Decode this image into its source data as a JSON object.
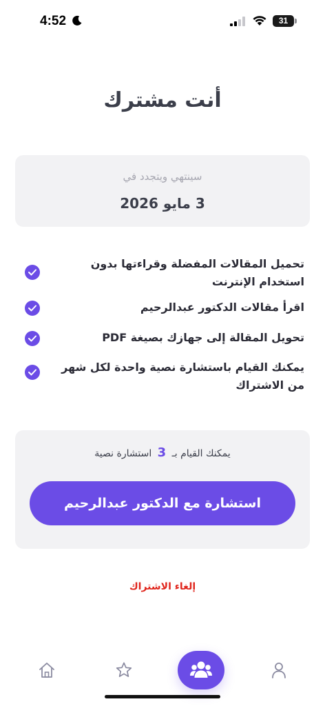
{
  "status_bar": {
    "time": "4:52",
    "battery": "31",
    "battery_level_percent": 31
  },
  "page": {
    "title": "أنت مشترك"
  },
  "renewal": {
    "label": "سينتهي ويتجدد في",
    "date": "3 مايو 2026"
  },
  "features": [
    {
      "text": "تحميل المقالات المفضلة وقراءتها بدون استخدام الإنترنت",
      "icon": "check-circle-icon"
    },
    {
      "text": "اقرأ مقالات الدكتور عبدالرحيم",
      "icon": "check-circle-icon"
    },
    {
      "text": "تحويل المقالة إلى جهازك بصيغة PDF",
      "icon": "check-circle-icon"
    },
    {
      "text": "يمكنك القيام باستشارة نصية واحدة لكل شهر من الاشتراك",
      "icon": "check-circle-icon"
    }
  ],
  "consultation": {
    "note_prefix": "يمكنك القيام بـ",
    "count": "3",
    "note_suffix": "استشارة نصية",
    "button_label": "استشارة مع الدكتور عبدالرحيم"
  },
  "cancel": {
    "label": "إلغاء الاشتراك"
  },
  "tab_bar": {
    "items": [
      {
        "icon": "home-icon",
        "active": false
      },
      {
        "icon": "star-icon",
        "active": false
      },
      {
        "icon": "users-icon",
        "active": true
      },
      {
        "icon": "person-icon",
        "active": false
      }
    ]
  },
  "colors": {
    "accent": "#6b4ce6",
    "card_background": "#f2f2f4",
    "danger": "#e0251c",
    "title": "#3b3e4a"
  }
}
